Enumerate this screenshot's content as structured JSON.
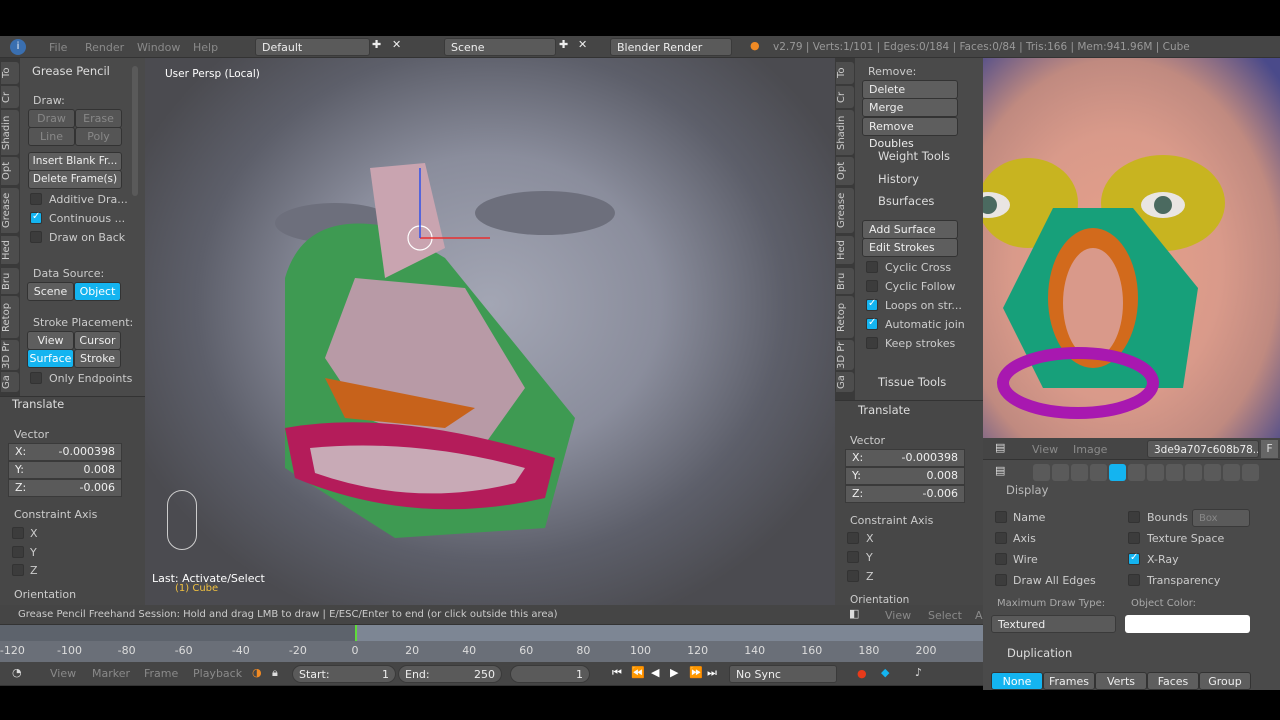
{
  "info_header": {
    "menus": [
      "File",
      "Render",
      "Window",
      "Help"
    ],
    "screen": "Default",
    "scene": "Scene",
    "engine": "Blender Render",
    "stats": "v2.79 | Verts:1/101 | Edges:0/184 | Faces:0/84 | Tris:166 | Mem:941.96M | Cube"
  },
  "left_tabs": [
    "To",
    "Cr",
    "Shadin",
    "Opt",
    "Grease",
    "Hed",
    "Bru",
    "Retop",
    "3D Pr",
    "Ga"
  ],
  "grease_pencil": {
    "title": "Grease Pencil",
    "draw_label": "Draw:",
    "draw": "Draw",
    "erase": "Erase",
    "line": "Line",
    "poly": "Poly",
    "insert": "Insert Blank Fr...",
    "delete": "Delete Frame(s)",
    "additive": "Additive Dra...",
    "continuous": "Continuous ...",
    "draw_on_back": "Draw on Back",
    "data_source": "Data Source:",
    "scene": "Scene",
    "object": "Object",
    "stroke_placement": "Stroke Placement:",
    "view": "View",
    "cursor": "Cursor",
    "surface": "Surface",
    "stroke": "Stroke",
    "only_endpoints": "Only Endpoints"
  },
  "translate_left": {
    "title": "Translate",
    "vector": "Vector",
    "x_label": "X:",
    "x": "-0.000398",
    "y_label": "Y:",
    "y": "0.008",
    "z_label": "Z:",
    "z": "-0.006",
    "constraint": "Constraint Axis",
    "cx": "X",
    "cy": "Y",
    "cz": "Z",
    "orientation": "Orientation"
  },
  "viewport": {
    "view_name": "User Persp (Local)",
    "last_op": "Last: Activate/Select",
    "object": "(1) Cube"
  },
  "status": "Grease Pencil Freehand Session: Hold and drag LMB to draw | E/ESC/Enter to end  (or click outside this area)",
  "right_tools": {
    "remove": "Remove:",
    "delete": "Delete",
    "merge": "Merge",
    "remove_doubles": "Remove Doubles",
    "weight_tools": "Weight Tools",
    "history": "History",
    "bsurfaces": "Bsurfaces",
    "add_surface": "Add Surface",
    "edit_strokes": "Edit Strokes",
    "cyclic_cross": "Cyclic Cross",
    "cyclic_follow": "Cyclic Follow",
    "loops": "Loops on str...",
    "auto_join": "Automatic join",
    "keep_strokes": "Keep strokes",
    "tissue": "Tissue Tools"
  },
  "translate_right": {
    "title": "Translate",
    "vector": "Vector",
    "x_label": "X:",
    "x": "-0.000398",
    "y_label": "Y:",
    "y": "0.008",
    "z_label": "Z:",
    "z": "-0.006",
    "constraint": "Constraint Axis",
    "cx": "X",
    "cy": "Y",
    "cz": "Z",
    "orientation": "Orientation"
  },
  "right_header": {
    "view": "View",
    "select": "Select",
    "a": "A"
  },
  "image_editor": {
    "view": "View",
    "image": "Image",
    "image_name": "3de9a707c608b78...",
    "f": "F"
  },
  "properties": {
    "display": "Display",
    "name": "Name",
    "axis": "Axis",
    "wire": "Wire",
    "draw_all_edges": "Draw All Edges",
    "bounds": "Bounds",
    "bounds_type": "Box",
    "texture_space": "Texture Space",
    "xray": "X-Ray",
    "transparency": "Transparency",
    "max_draw_type": "Maximum Draw Type:",
    "draw_type": "Textured",
    "object_color": "Object Color:",
    "duplication": "Duplication",
    "dup_options": [
      "None",
      "Frames",
      "Verts",
      "Faces",
      "Group"
    ]
  },
  "timeline": {
    "ticks": [
      "-120",
      "-100",
      "-80",
      "-60",
      "-40",
      "-20",
      "0",
      "20",
      "40",
      "60",
      "80",
      "100",
      "120",
      "140",
      "160",
      "180",
      "200"
    ],
    "menus": [
      "View",
      "Marker",
      "Frame",
      "Playback"
    ],
    "start_label": "Start:",
    "start": "1",
    "end_label": "End:",
    "end": "250",
    "current": "1",
    "sync": "No Sync",
    "accent": "#14b4f0"
  }
}
